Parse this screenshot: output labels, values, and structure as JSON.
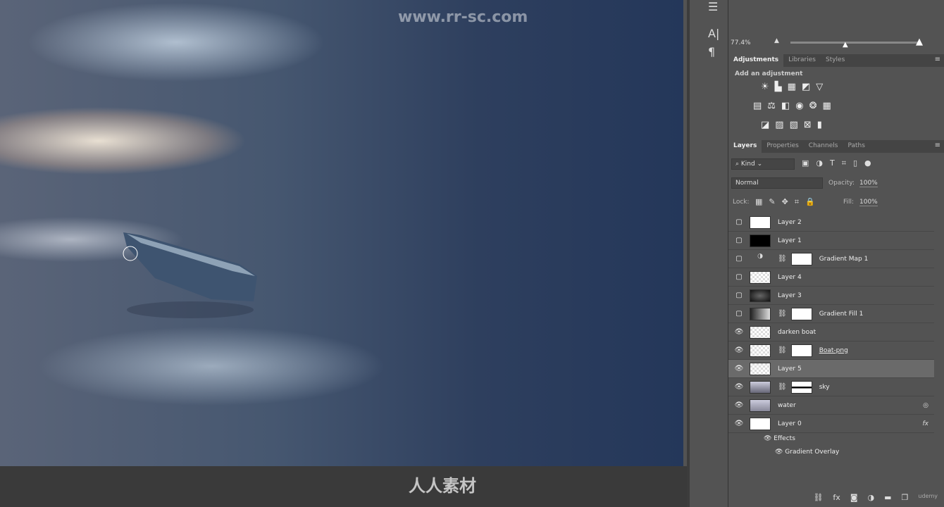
{
  "watermarks": {
    "top": "www.rr-sc.com",
    "bottom": "人人素材",
    "brand": "udemy"
  },
  "zoom": {
    "value": "77.4%",
    "slider_fraction": 0.55
  },
  "adjustments": {
    "tabs": [
      "Adjustments",
      "Libraries",
      "Styles"
    ],
    "heading": "Add an adjustment",
    "rows": [
      [
        "☀",
        "▙",
        "▦",
        "◩",
        "▽"
      ],
      [
        "▤",
        "⚖",
        "◧",
        "◉",
        "❂",
        "▦"
      ],
      [
        "◪",
        "▨",
        "▧",
        "⊠",
        "▮"
      ]
    ]
  },
  "layers_panel": {
    "tabs": [
      "Layers",
      "Properties",
      "Channels",
      "Paths"
    ],
    "filter": "Kind",
    "blend_mode": "Normal",
    "opacity_label": "Opacity:",
    "opacity": "100%",
    "lock_label": "Lock:",
    "fill_label": "Fill:",
    "fill": "100%",
    "layers": [
      {
        "name": "Layer 2",
        "visible": false
      },
      {
        "name": "Layer 1",
        "visible": false
      },
      {
        "name": "Gradient Map 1",
        "visible": false
      },
      {
        "name": "Layer 4",
        "visible": false
      },
      {
        "name": "Layer 3",
        "visible": false
      },
      {
        "name": "Gradient Fill 1",
        "visible": false
      },
      {
        "name": "darken boat",
        "visible": true
      },
      {
        "name": "Boat-png",
        "visible": true
      },
      {
        "name": "Layer 5",
        "visible": true,
        "selected": true
      },
      {
        "name": "sky",
        "visible": true
      },
      {
        "name": "water",
        "visible": true
      },
      {
        "name": "Layer 0",
        "visible": true
      }
    ],
    "effects": {
      "label": "Effects",
      "items": [
        "Gradient Overlay"
      ]
    }
  }
}
